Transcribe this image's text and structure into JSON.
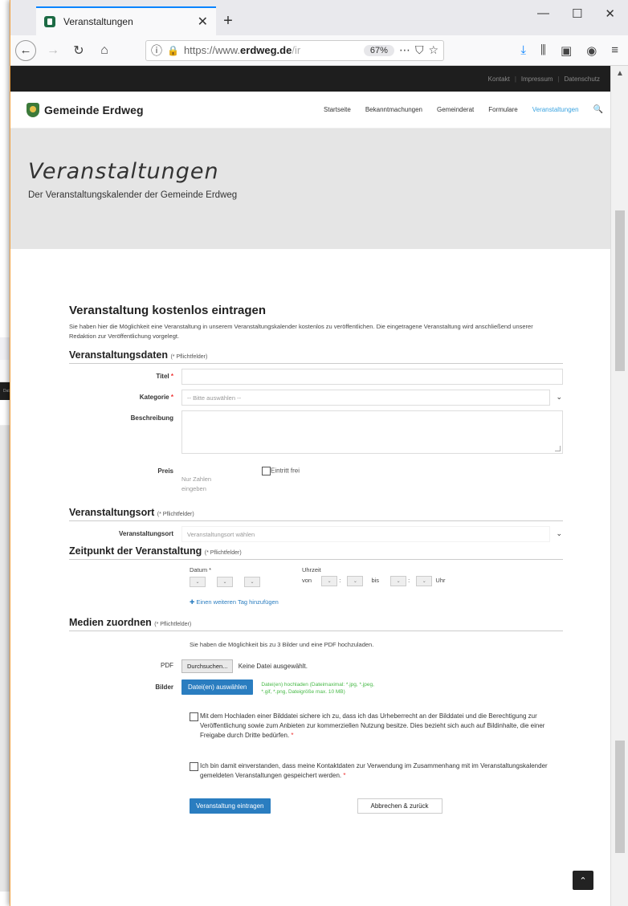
{
  "browser": {
    "tab_title": "Veranstaltungen",
    "url_prefix": "https://www.",
    "url_host": "erdweg.de",
    "url_rest": "/ir",
    "zoom": "67%"
  },
  "bg_window": {
    "topbar_text": "Datenschutz"
  },
  "site": {
    "topbar": [
      "Kontakt",
      "Impressum",
      "Datenschutz"
    ],
    "name": "Gemeinde Erdweg",
    "nav": [
      "Startseite",
      "Bekanntmachungen",
      "Gemeinderat",
      "Formulare",
      "Veranstaltungen"
    ]
  },
  "hero": {
    "title": "Veranstaltungen",
    "subtitle": "Der Veranstaltungskalender der Gemeinde Erdweg"
  },
  "form": {
    "heading": "Veranstaltung kostenlos eintragen",
    "intro": "Sie haben hier die Möglichkeit eine Veranstaltung in unserem Veranstaltungskalender kostenlos zu veröffentlichen. Die eingetragene Veranstaltung wird anschließend unserer Redaktion zur Veröffentlichung vorgelegt.",
    "required_note": "(* Pflichtfelder)",
    "sec_data": "Veranstaltungsdaten",
    "label_title": "Titel",
    "label_category": "Kategorie",
    "category_placeholder": "-- Bitte auswählen --",
    "label_description": "Beschreibung",
    "label_price": "Preis",
    "free_entry": "Eintritt frei",
    "price_hint_1": "Nur Zahlen",
    "price_hint_2": "eingeben",
    "sec_location": "Veranstaltungsort",
    "label_location": "Veranstaltungsort",
    "location_placeholder": "Veranstaltungsort wählen",
    "sec_time": "Zeitpunkt der Veranstaltung",
    "label_date": "Datum",
    "label_time": "Uhrzeit",
    "time_from": "von",
    "time_to": "bis",
    "time_unit": "Uhr",
    "add_day": "Einen weiteren Tag hinzufügen",
    "sec_media": "Medien zuordnen",
    "media_hint": "Sie haben die Möglichkeit bis zu 3 Bilder und eine PDF hochzuladen.",
    "label_pdf": "PDF",
    "browse": "Durchsuchen...",
    "no_file": "Keine Datei ausgewählt.",
    "label_images": "Bilder",
    "choose_files": "Datei(en) auswählen",
    "file_limits_1": "Datei(en) hochladen (Dateimaximal: *.jpg, *.jpeg,",
    "file_limits_2": "*.gif, *.png, Dateigröße max. 10 MB)",
    "consent_copyright": "Mit dem Hochladen einer Bilddatei sichere ich zu, dass ich das Urheberrecht an der Bilddatei und die Berechtigung zur Veröffentlichung sowie zum Anbieten zur kommerziellen Nutzung besitze. Dies bezieht sich auch auf Bildinhalte, die einer Freigabe durch Dritte bedürfen.",
    "consent_contact": "Ich bin damit einverstanden, dass meine Kontaktdaten zur Verwendung im Zusammenhang mit im Veranstaltungskalender gemeldeten Veranstaltungen gespeichert werden.",
    "submit": "Veranstaltung eintragen",
    "cancel": "Abbrechen & zurück"
  }
}
